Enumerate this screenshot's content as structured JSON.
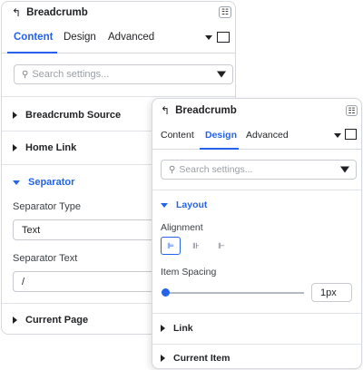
{
  "panel_back": {
    "title": "Breadcrumb",
    "tabs": [
      "Content",
      "Design",
      "Advanced"
    ],
    "active_tab": "Content",
    "search_placeholder": "Search settings...",
    "sections": {
      "breadcrumb_source": "Breadcrumb Source",
      "home_link": "Home Link",
      "separator": "Separator",
      "current_page": "Current Page"
    },
    "separator_type_label": "Separator Type",
    "separator_type_value": "Text",
    "separator_text_label": "Separator Text",
    "separator_text_value": "/"
  },
  "panel_front": {
    "title": "Breadcrumb",
    "tabs": [
      "Content",
      "Design",
      "Advanced"
    ],
    "active_tab": "Design",
    "search_placeholder": "Search settings...",
    "sections": {
      "layout": "Layout",
      "link": "Link",
      "current_item": "Current Item"
    },
    "alignment_label": "Alignment",
    "item_spacing_label": "Item Spacing",
    "item_spacing_value": "1px",
    "item_spacing_slider_fraction": 0.0
  },
  "icons": {
    "back": "back-arrow-icon",
    "menu": "panel-menu-icon",
    "dropdown": "chevron-down-icon",
    "responsive": "desktop-icon",
    "search": "search-icon",
    "filter": "filter-icon",
    "align_left": "align-left-icon",
    "align_center": "align-center-icon",
    "align_right": "align-right-icon"
  },
  "colors": {
    "accent": "#2563eb",
    "border": "#d5d8dc",
    "text": "#1f2124"
  }
}
